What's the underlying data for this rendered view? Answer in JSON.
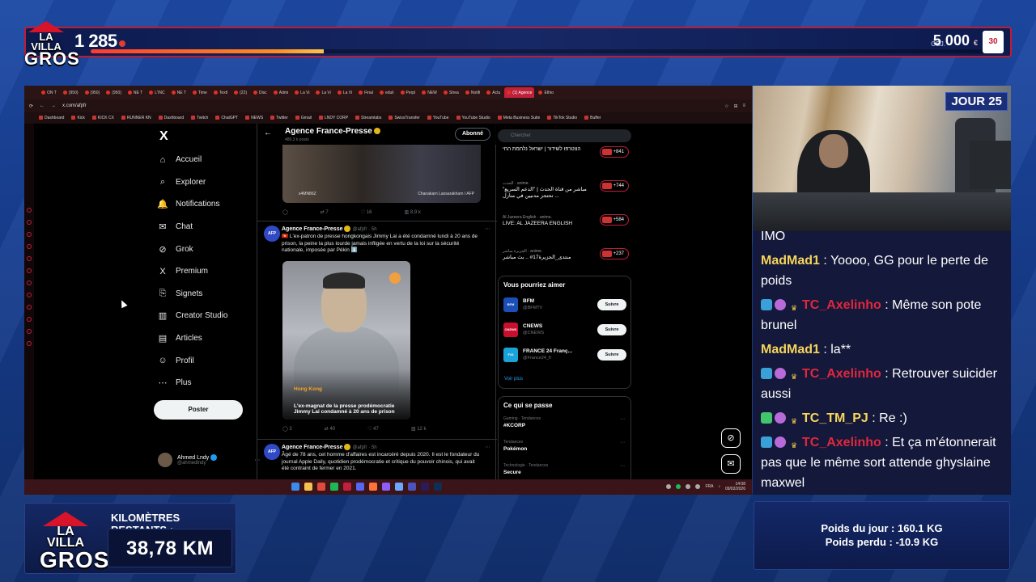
{
  "overlay": {
    "sub_count": "1 285",
    "goal_label": "OBJ.",
    "goal_value": "5 000",
    "goal_currency": "€",
    "progress_fraction": 0.257,
    "badge": "30",
    "logo_line1": "LA VILLA",
    "logo_line2": "GROS",
    "day_label": "JOUR 25",
    "km_label_bold": "KILOMÈTRES",
    "km_label_rest": " RESTANTS :",
    "km_value": "38,78 KM",
    "weight_today": "Poids du jour : 160.1 KG",
    "weight_lost": "Poids perdu : -10.9 KG"
  },
  "browser": {
    "tabs": [
      "ON T",
      "(950)",
      "(950)",
      "(950)",
      "NE T",
      "L'INC",
      "NE T",
      "Time",
      "Textl",
      "(22)",
      "Disc",
      "Admi",
      "La Vi",
      "La Vi",
      "La Vi",
      "Final",
      "eduli",
      "Perpl",
      "NEW",
      "Strea",
      "Notifi",
      "Actu",
      "(1) Agence",
      "Ethio"
    ],
    "active_tab_index": 22,
    "url": "x.com/afpfr",
    "bookmarks": [
      "Dashboard",
      "Kick",
      "KICK CX",
      "RUNNER KN",
      "Dashboard",
      "Twitch",
      "ChatGPT",
      "NEWS",
      "Twitter",
      "Gmail",
      "LNDY CORP",
      "Streamlabs",
      "SwissTransfer",
      "YouTube",
      "YouTube Studio",
      "Meta Business Suite",
      "TikTok Studio",
      "Buffer"
    ]
  },
  "xnav": {
    "logo": "X",
    "items": [
      {
        "label": "Accueil",
        "icon": "⌂"
      },
      {
        "label": "Explorer",
        "icon": "⌕"
      },
      {
        "label": "Notifications",
        "icon": "🔔"
      },
      {
        "label": "Chat",
        "icon": "✉"
      },
      {
        "label": "Grok",
        "icon": "⊘"
      },
      {
        "label": "Premium",
        "icon": "X"
      },
      {
        "label": "Signets",
        "icon": "⎘"
      },
      {
        "label": "Creator Studio",
        "icon": "▥"
      },
      {
        "label": "Articles",
        "icon": "▤"
      },
      {
        "label": "Profil",
        "icon": "☺"
      },
      {
        "label": "Plus",
        "icon": "⋯"
      }
    ],
    "post_button": "Poster",
    "user_name": "Ahmed Lndy",
    "user_handle": "@ahmedlndy"
  },
  "feed": {
    "account_name": "Agence France-Presse",
    "posts_count": "486,3 k posts",
    "follow_state": "Abonné",
    "top_image_caption_left": "s4MN86Z",
    "top_image_caption_right": "Chanakarn Laosarakham / AFP",
    "top_actions": [
      "",
      "7",
      "16",
      "8,9 k"
    ],
    "post1": {
      "avatar": "AFP",
      "name": "Agence France-Presse",
      "handle": "@afpfr · 5h",
      "text": "🇭🇰 L'ex-patron de presse hongkongais Jimmy Lai a été condamné lundi à 20 ans de prison, la peine la plus lourde jamais infligée en vertu de la loi sur la sécurité nationale, imposée par Pékin ⬇️",
      "image_location": "Hong Kong",
      "image_caption": "L'ex-magnat de la presse prodémocratie Jimmy Lai condamné à 20 ans de prison",
      "actions": [
        "3",
        "40",
        "47",
        "12 k"
      ]
    },
    "post2": {
      "avatar": "AFP",
      "name": "Agence France-Presse",
      "handle": "@afpfr · 5h",
      "text": "Âgé de 78 ans, cet homme d'affaires est incarcéré depuis 2020. Il est le fondateur du journal Apple Daily, quotidien prodémocratie et critique du pouvoir chinois, qui avait été contraint de fermer en 2021."
    }
  },
  "right": {
    "search_placeholder": "Chercher",
    "live": [
      {
        "source": "",
        "title": "הצטרפו לשידור | ישראל נלחמת החי",
        "count": "+841"
      },
      {
        "source": "الحدث · anime.",
        "title": "مباشر من قناة الحدث | \"الدعم السريع\" تحتجز مدنيين في منازل ...",
        "count": "+744"
      },
      {
        "source": "Al Jazeera English · anime.",
        "title": "LIVE: AL JAZEERA ENGLISH",
        "count": "+584"
      },
      {
        "source": "الجزيرة مباشر · anime.",
        "title": "منتدى_الجزيرة17# .. بث مباشر",
        "count": "+237"
      }
    ],
    "suggest_title": "Vous pourriez aimer",
    "suggestions": [
      {
        "logo": "BFM",
        "name": "BFM",
        "handle": "@BFMTV",
        "button": "Suivre"
      },
      {
        "logo": "CNEWS",
        "name": "CNEWS",
        "handle": "@CNEWS",
        "button": "Suivre"
      },
      {
        "logo": "F24",
        "name": "FRANCE 24 Franç...",
        "handle": "@France24_fr",
        "button": "Suivre"
      }
    ],
    "see_more": "Voir plus",
    "trends_title": "Ce qui se passe",
    "trends": [
      {
        "category": "Gaming · Tendances",
        "value": "#KCORP"
      },
      {
        "category": "Tendances",
        "value": "Pokémon"
      },
      {
        "category": "Technologie · Tendances",
        "value": "Secure"
      }
    ]
  },
  "taskbar": {
    "lang": "FRA",
    "time": "14:08",
    "date": "09/02/2026"
  },
  "chat": {
    "messages": [
      {
        "user": "",
        "text": "IMO",
        "badges": []
      },
      {
        "user": "MadMad1",
        "text": " : Yoooo, GG pour le perte de poids",
        "badges": []
      },
      {
        "user": "TC_Axelinho",
        "text": " : Même son pote brunel",
        "badges": [
          "b1",
          "b2",
          "b3"
        ]
      },
      {
        "user": "MadMad1",
        "text": " : la**",
        "badges": []
      },
      {
        "user": "TC_Axelinho",
        "text": " : Retrouver suicider aussi",
        "badges": [
          "b1",
          "b2",
          "b3"
        ]
      },
      {
        "user": "TC_TM_PJ",
        "text": " : Re :)",
        "badges": [
          "b4",
          "b2",
          "b3"
        ]
      },
      {
        "user": "TC_Axelinho",
        "text": " : Et ça m'étonnerait pas que le même sort attende ghyslaine maxwel",
        "badges": [
          "b1",
          "b2",
          "b3"
        ]
      }
    ]
  }
}
